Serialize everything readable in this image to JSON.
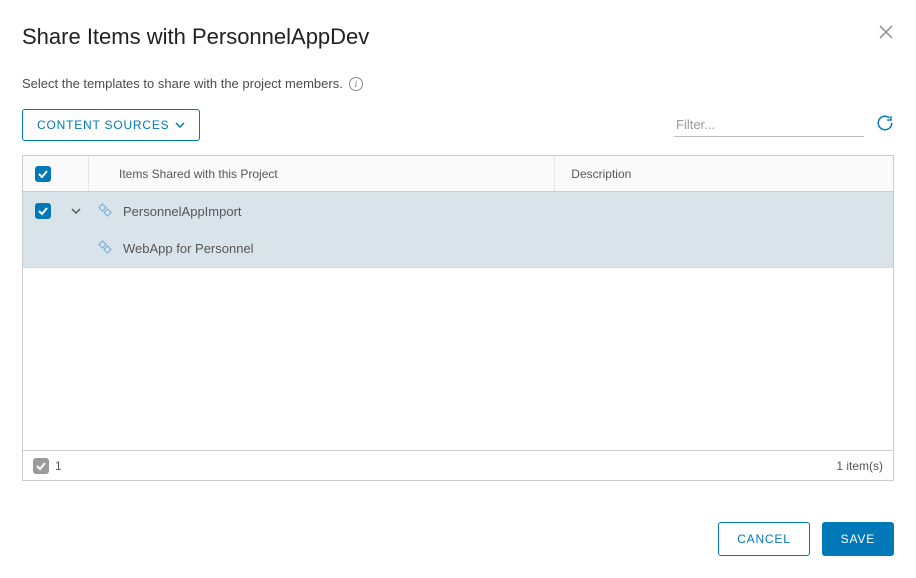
{
  "dialog": {
    "title": "Share Items with PersonnelAppDev",
    "subtitle": "Select the templates to share with the project members."
  },
  "toolbar": {
    "content_sources_label": "CONTENT SOURCES",
    "filter_placeholder": "Filter..."
  },
  "table": {
    "headers": {
      "items": "Items Shared with this Project",
      "description": "Description"
    },
    "rows": [
      {
        "name": "PersonnelAppImport",
        "description": "",
        "checked": true,
        "expanded": true
      },
      {
        "name": "WebApp for Personnel",
        "description": "",
        "child": true
      }
    ],
    "footer": {
      "selected_count": "1",
      "item_count_label": "1 item(s)"
    }
  },
  "buttons": {
    "cancel": "CANCEL",
    "save": "SAVE"
  }
}
